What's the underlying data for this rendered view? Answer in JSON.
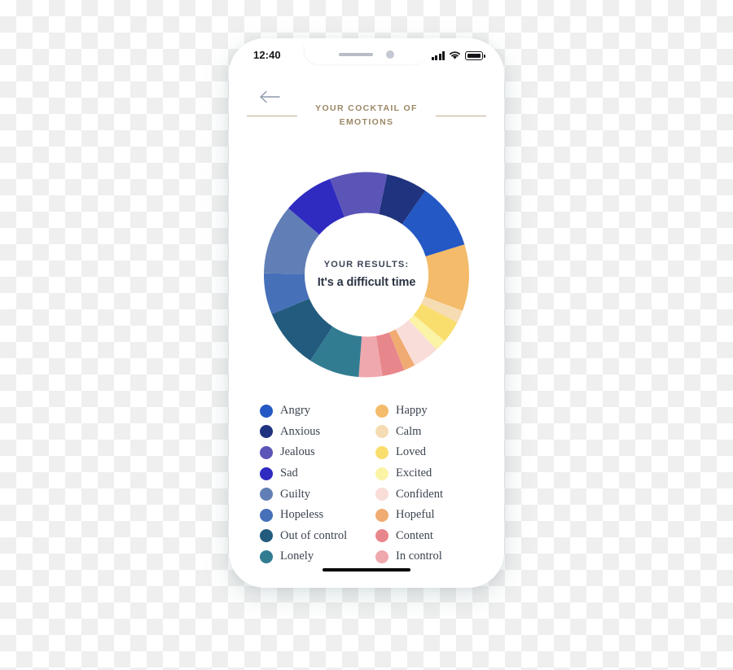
{
  "status_bar": {
    "time": "12:40",
    "signal_icon": "cellular-signal-icon",
    "wifi_icon": "wifi-icon",
    "battery_icon": "battery-full-icon"
  },
  "header": {
    "back_icon": "back-arrow-icon",
    "title": "YOUR COCKTAIL OF EMOTIONS",
    "rule_color": "#c0ab92",
    "title_color": "#9b8765"
  },
  "center": {
    "label": "YOUR RESULTS:",
    "value": "It's a difficult time"
  },
  "chart_data": {
    "type": "pie",
    "title": "YOUR COCKTAIL OF EMOTIONS",
    "subtitle": "It's a difficult time",
    "legend_position": "bottom",
    "grid": false,
    "donut": true,
    "inner_radius_ratio": 0.6,
    "start_angle_deg": -55,
    "categories": [
      "Angry",
      "Happy",
      "Calm",
      "Loved",
      "Excited",
      "Confident",
      "Hopeful",
      "Content",
      "In control",
      "Lonely",
      "Out of control",
      "Hopeless",
      "Guilty",
      "Sad",
      "Jealous",
      "Anxious"
    ],
    "values": [
      10.5,
      10.5,
      2.0,
      3.5,
      1.8,
      4.2,
      1.8,
      3.5,
      3.7,
      8.0,
      9.5,
      6.5,
      11.0,
      8.0,
      9.0,
      6.5
    ],
    "colors": [
      "#2458c4",
      "#f3bb6a",
      "#f6dcb2",
      "#f9de6e",
      "#fbf4a6",
      "#f9ddd8",
      "#f0ab72",
      "#e8878b",
      "#efa8ad",
      "#327c92",
      "#225b7e",
      "#4670b8",
      "#617fb6",
      "#2f2bc0",
      "#5c55b8",
      "#1f337e"
    ]
  },
  "legend": {
    "left_column": [
      {
        "label": "Angry",
        "color": "#2458c4"
      },
      {
        "label": "Anxious",
        "color": "#1f337e"
      },
      {
        "label": "Jealous",
        "color": "#5c55b8"
      },
      {
        "label": "Sad",
        "color": "#2f2bc0"
      },
      {
        "label": "Guilty",
        "color": "#617fb6"
      },
      {
        "label": "Hopeless",
        "color": "#4670b8"
      },
      {
        "label": "Out of control",
        "color": "#225b7e"
      },
      {
        "label": "Lonely",
        "color": "#327c92"
      }
    ],
    "right_column": [
      {
        "label": "Happy",
        "color": "#f3bb6a"
      },
      {
        "label": "Calm",
        "color": "#f6dcb2"
      },
      {
        "label": "Loved",
        "color": "#f9de6e"
      },
      {
        "label": "Excited",
        "color": "#fbf4a6"
      },
      {
        "label": "Confident",
        "color": "#f9ddd8"
      },
      {
        "label": "Hopeful",
        "color": "#f0ab72"
      },
      {
        "label": "Content",
        "color": "#e8878b"
      },
      {
        "label": "In control",
        "color": "#efa8ad"
      }
    ]
  },
  "home_indicator": "home-indicator"
}
